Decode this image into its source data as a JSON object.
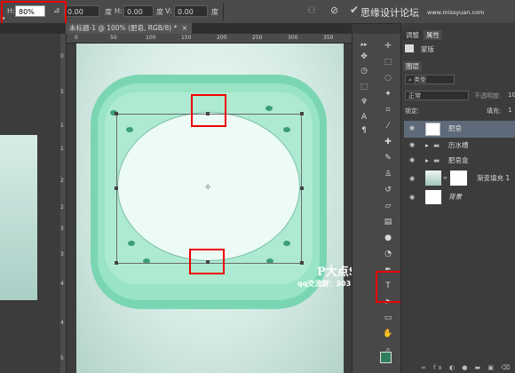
{
  "options_bar": {
    "h_label": "H:",
    "h_value": "80%",
    "angle_value": "0.00",
    "angle_unit": "度",
    "h_skew_label": "H:",
    "h_skew_value": "0.00",
    "h_skew_unit": "度",
    "v_label": "V:",
    "v_value": "0.00",
    "v_unit": "度",
    "brand": "思缘设计论坛",
    "brand_url": "www.missyuan.com"
  },
  "document": {
    "tab_label": "未标题-1 @ 100% (肥皂, RGB/8) *",
    "close": "×"
  },
  "rulers": {
    "top": [
      "0",
      "50",
      "100",
      "150",
      "200",
      "250",
      "300",
      "350"
    ],
    "left": [
      "0",
      "5",
      "1",
      "1",
      "2",
      "2",
      "3",
      "3",
      "4",
      "4",
      "5"
    ]
  },
  "watermark": {
    "title": "P大点S",
    "qq_text": "qq交流群：303184032"
  },
  "right_panel": {
    "top_tabs": [
      "调整",
      "属性"
    ],
    "mask_label": "蒙版",
    "layers_tab": "图层",
    "kind_label": "类型",
    "blend_mode": "正常",
    "opacity_label": "不透明度:",
    "opacity_value": "10",
    "lock_label": "锁定:",
    "fill_label": "填充:",
    "fill_value": "1",
    "layers": [
      {
        "name": "肥皂"
      },
      {
        "name": "历水槽"
      },
      {
        "name": "肥皂盒"
      },
      {
        "name": "渐变填充 1"
      },
      {
        "name": "背景"
      }
    ]
  },
  "colors": {
    "foreground": "#2e7d5b",
    "background": "#111111",
    "highlight": "#ee0000"
  }
}
